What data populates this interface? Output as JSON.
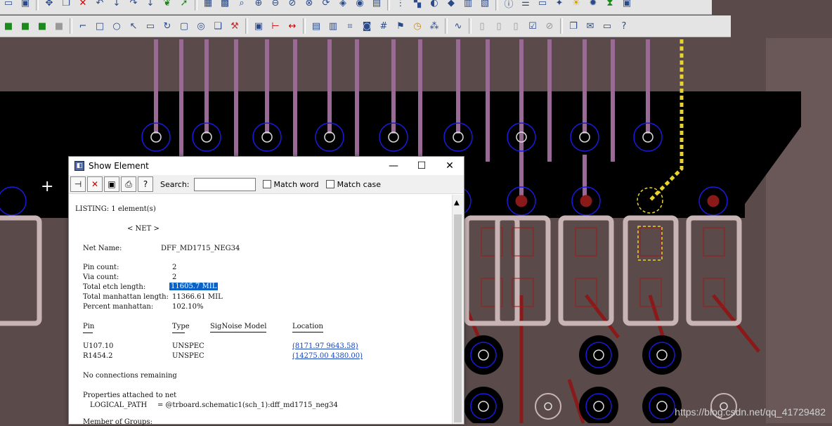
{
  "dialog": {
    "title": "Show Element",
    "search_label": "Search:",
    "search_value": "",
    "match_word_label": "Match word",
    "match_case_label": "Match case",
    "listing": {
      "header": "LISTING: 1 element(s)",
      "section": "< NET >",
      "net_name_label": "Net Name:",
      "net_name_value": "DFF_MD1715_NEG34",
      "pin_count_label": "Pin count:",
      "pin_count_value": "2",
      "via_count_label": "Via count:",
      "via_count_value": "2",
      "etch_label": "Total etch length:",
      "etch_value": "11605.7 MIL",
      "manhattan_label": "Total manhattan length:",
      "manhattan_value": "11366.61 MIL",
      "percent_label": "Percent manhattan:",
      "percent_value": "102.10%",
      "col_pin": "Pin",
      "col_type": "Type",
      "col_model": "SigNoise Model",
      "col_location": "Location",
      "rows": [
        {
          "pin": "U107.10",
          "type": "UNSPEC",
          "location": "(8171.97 9643.58)"
        },
        {
          "pin": "R1454.2",
          "type": "UNSPEC",
          "location": "(14275.00 4380.00)"
        }
      ],
      "no_connections": "No connections remaining",
      "props_header": "Properties attached to net",
      "logical_path_label": "LOGICAL_PATH",
      "logical_path_value": "= @trboard.schematic1(sch_1):dff_md1715_neg34",
      "member_groups": "Member of Groups:"
    }
  },
  "watermark": "https://blog.csdn.net/qq_41729482",
  "colors": {
    "board": "#5a4a4a",
    "etch": "#000000",
    "trace": "#9a6a96",
    "via_ring": "#1a1ae0",
    "highlight_trace": "#e8d230",
    "pad": "#c8b4b4",
    "red_trace": "#8a1a1a"
  }
}
